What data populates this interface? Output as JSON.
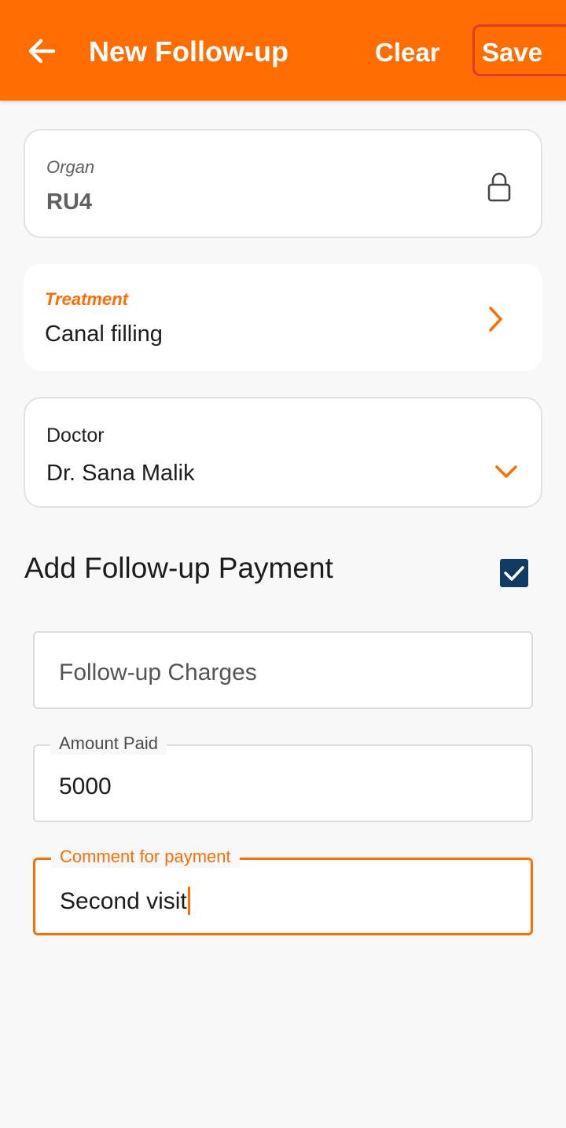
{
  "header": {
    "title": "New Follow-up",
    "clear_label": "Clear",
    "save_label": "Save",
    "accent_color": "#ff6d00"
  },
  "organ": {
    "label": "Organ",
    "value": "RU4",
    "icon": "lock-icon"
  },
  "treatment": {
    "label": "Treatment",
    "value": "Canal filling",
    "icon": "chevron-right-icon"
  },
  "doctor": {
    "label": "Doctor",
    "value": "Dr. Sana Malik",
    "icon": "chevron-down-icon"
  },
  "payment": {
    "section_title": "Add Follow-up Payment",
    "enabled": true,
    "charges_placeholder": "Follow-up Charges",
    "amount_label": "Amount Paid",
    "amount_value": "5000",
    "comment_label": "Comment for payment",
    "comment_value": "Second visit"
  }
}
